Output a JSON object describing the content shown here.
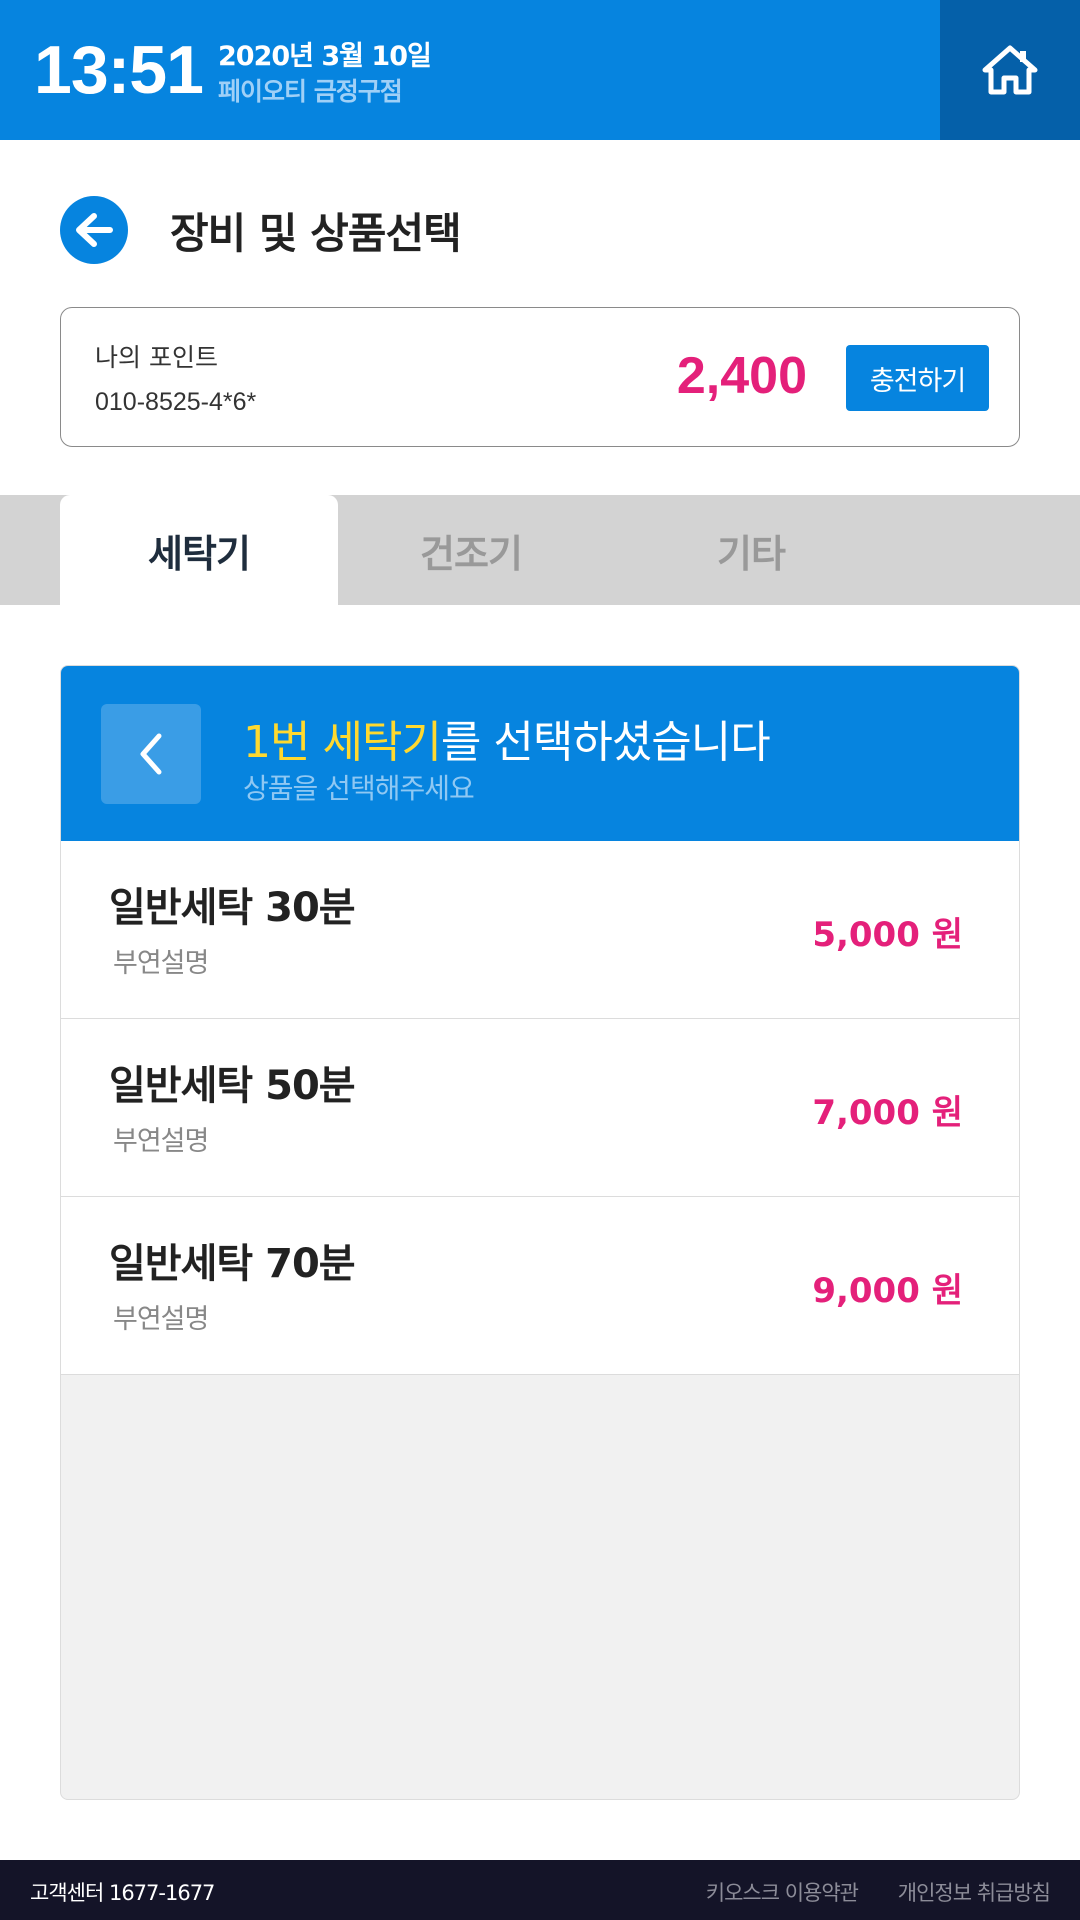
{
  "header": {
    "time": "13:51",
    "date": "2020년 3월 10일",
    "store": "페이오티 금정구점",
    "home_icon": "home-icon"
  },
  "title_bar": {
    "back_icon": "arrow-left-icon",
    "title": "장비 및 상품선택"
  },
  "points": {
    "label": "나의 포인트",
    "phone": "010-8525-4*6*",
    "value": "2,400",
    "charge_label": "충전하기"
  },
  "tabs": [
    {
      "label": "세탁기",
      "active": true
    },
    {
      "label": "건조기",
      "active": false
    },
    {
      "label": "기타",
      "active": false
    }
  ],
  "panel": {
    "back_icon": "chevron-left-icon",
    "title_highlight": "1번 세탁기",
    "title_rest": "를 선택하셨습니다",
    "subtitle": "상품을 선택해주세요"
  },
  "products": [
    {
      "name": "일반세탁 30분",
      "desc": "부연설명",
      "price": "5,000 원"
    },
    {
      "name": "일반세탁 50분",
      "desc": "부연설명",
      "price": "7,000 원"
    },
    {
      "name": "일반세탁 70분",
      "desc": "부연설명",
      "price": "9,000 원"
    }
  ],
  "footer": {
    "support": "고객센터 1677-1677",
    "terms": "키오스크 이용약관",
    "privacy": "개인정보 취급방침"
  },
  "colors": {
    "primary": "#0684df",
    "primary_dark": "#0560a9",
    "accent_pink": "#e4207a",
    "highlight_yellow": "#ffd92f",
    "footer_bg": "#141428"
  }
}
